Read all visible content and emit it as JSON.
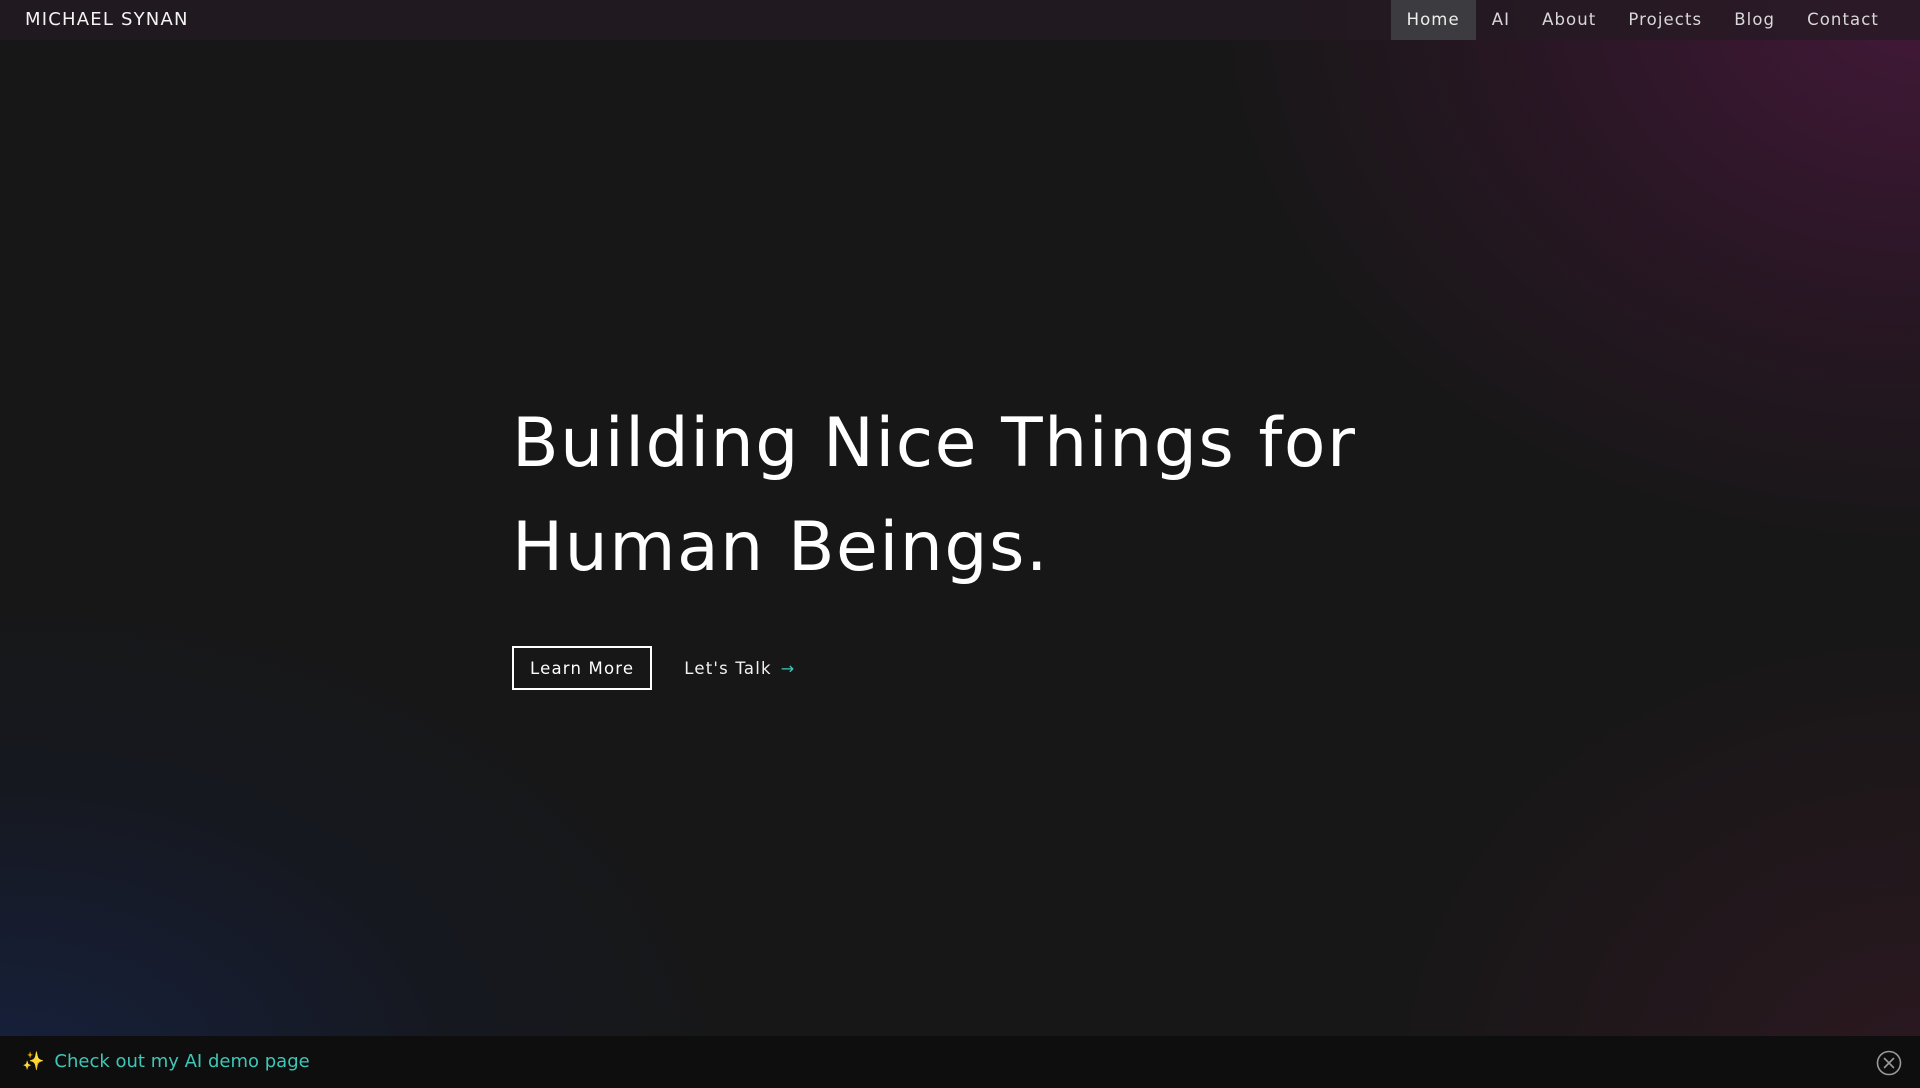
{
  "header": {
    "brand": "MICHAEL SYNAN",
    "nav": [
      {
        "label": "Home",
        "active": true
      },
      {
        "label": "AI",
        "active": false
      },
      {
        "label": "About",
        "active": false
      },
      {
        "label": "Projects",
        "active": false
      },
      {
        "label": "Blog",
        "active": false
      },
      {
        "label": "Contact",
        "active": false
      }
    ]
  },
  "hero": {
    "headline_line1": "Building Nice Things for",
    "headline_line2": "Human Beings.",
    "primary_button": "Learn More",
    "secondary_link": "Let's Talk",
    "secondary_link_icon": "arrow-right-icon"
  },
  "banner": {
    "icon": "sparkles-icon",
    "text": "Check out my AI demo page",
    "close_icon": "close-circle-icon"
  },
  "colors": {
    "accent": "#3ec7b8",
    "active_nav_bg": "#3c3c40",
    "banner_bg": "#0f0e0e"
  }
}
